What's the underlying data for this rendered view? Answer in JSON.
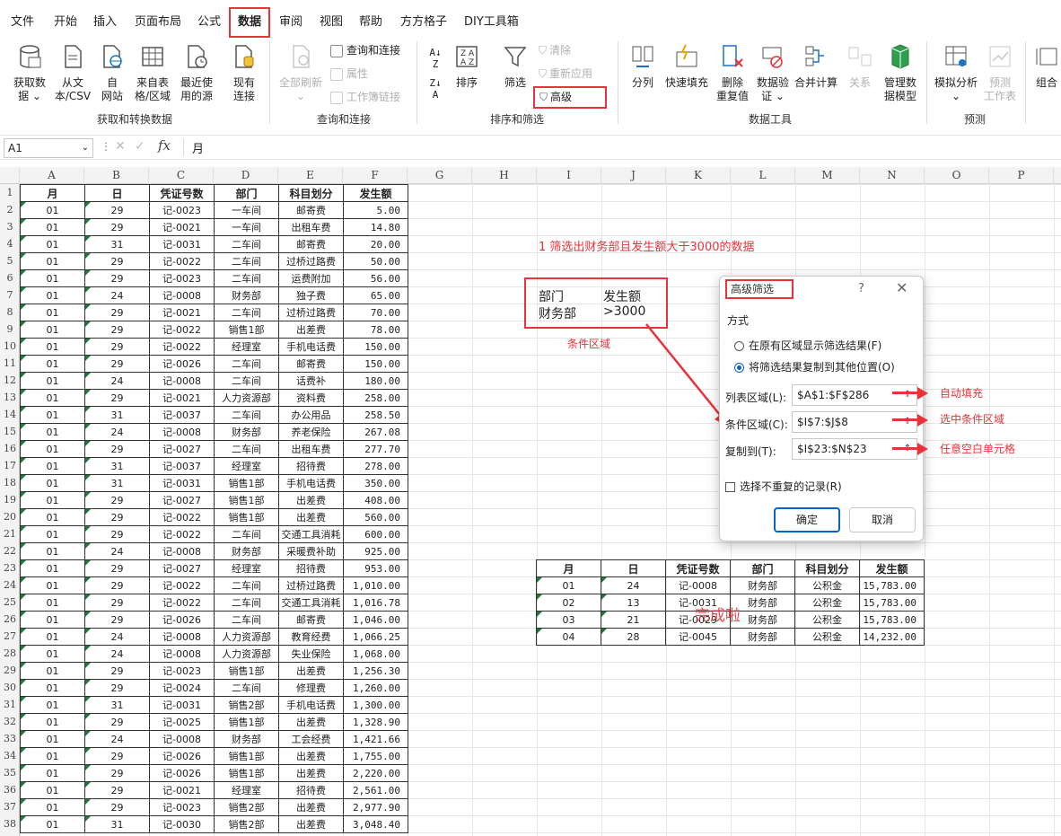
{
  "tabs": [
    "文件",
    "开始",
    "插入",
    "页面布局",
    "公式",
    "数据",
    "审阅",
    "视图",
    "帮助",
    "方方格子",
    "DIY工具箱"
  ],
  "ribbon": {
    "get_data": [
      "获取数\n据 ⌄",
      "从文\n本/CSV",
      "自\n网站",
      "来自表\n格/区域",
      "最近使\n用的源",
      "现有\n连接"
    ],
    "group1": "获取和转换数据",
    "refresh_all": "全部刷新\n⌄",
    "queries": [
      "查询和连接",
      "属性",
      "工作簿链接"
    ],
    "group2": "查询和连接",
    "sort": "排序",
    "filter": "筛选",
    "clear": "清除",
    "reapply": "重新应用",
    "advanced": "高级",
    "group3": "排序和筛选",
    "tools": [
      "分列",
      "快速填充",
      "删除\n重复值",
      "数据验\n证 ⌄",
      "合并计算",
      "关系",
      "管理数\n据模型"
    ],
    "group4": "数据工具",
    "forecast": [
      "模拟分析\n⌄",
      "预测\n工作表"
    ],
    "group5": "预测",
    "outline": "组合"
  },
  "formula_bar": {
    "name_box": "A1",
    "value": "月"
  },
  "columns": [
    "A",
    "B",
    "C",
    "D",
    "E",
    "F",
    "G",
    "H",
    "I",
    "J",
    "K",
    "L",
    "M",
    "N",
    "O",
    "P"
  ],
  "rows": [
    "1",
    "2",
    "3",
    "4",
    "5",
    "6",
    "7",
    "8",
    "9",
    "10",
    "11",
    "12",
    "13",
    "14",
    "15",
    "16",
    "17",
    "18",
    "19",
    "20",
    "21",
    "22",
    "23",
    "24",
    "25",
    "26",
    "27",
    "28",
    "29",
    "30",
    "31",
    "32",
    "33",
    "34",
    "35",
    "36",
    "37",
    "38"
  ],
  "headers": [
    "月",
    "日",
    "凭证号数",
    "部门",
    "科目划分",
    "发生额"
  ],
  "records": [
    [
      "01",
      "29",
      "记-0023",
      "一车间",
      "邮寄费",
      "5.00"
    ],
    [
      "01",
      "29",
      "记-0021",
      "一车间",
      "出租车费",
      "14.80"
    ],
    [
      "01",
      "31",
      "记-0031",
      "二车间",
      "邮寄费",
      "20.00"
    ],
    [
      "01",
      "29",
      "记-0022",
      "二车间",
      "过桥过路费",
      "50.00"
    ],
    [
      "01",
      "29",
      "记-0023",
      "二车间",
      "运费附加",
      "56.00"
    ],
    [
      "01",
      "24",
      "记-0008",
      "财务部",
      "独子费",
      "65.00"
    ],
    [
      "01",
      "29",
      "记-0021",
      "二车间",
      "过桥过路费",
      "70.00"
    ],
    [
      "01",
      "29",
      "记-0022",
      "销售1部",
      "出差费",
      "78.00"
    ],
    [
      "01",
      "29",
      "记-0022",
      "经理室",
      "手机电话费",
      "150.00"
    ],
    [
      "01",
      "29",
      "记-0026",
      "二车间",
      "邮寄费",
      "150.00"
    ],
    [
      "01",
      "24",
      "记-0008",
      "二车间",
      "话费补",
      "180.00"
    ],
    [
      "01",
      "29",
      "记-0021",
      "人力资源部",
      "资料费",
      "258.00"
    ],
    [
      "01",
      "31",
      "记-0037",
      "二车间",
      "办公用品",
      "258.50"
    ],
    [
      "01",
      "24",
      "记-0008",
      "财务部",
      "养老保险",
      "267.08"
    ],
    [
      "01",
      "29",
      "记-0027",
      "二车间",
      "出租车费",
      "277.70"
    ],
    [
      "01",
      "31",
      "记-0037",
      "经理室",
      "招待费",
      "278.00"
    ],
    [
      "01",
      "31",
      "记-0031",
      "销售1部",
      "手机电话费",
      "350.00"
    ],
    [
      "01",
      "29",
      "记-0027",
      "销售1部",
      "出差费",
      "408.00"
    ],
    [
      "01",
      "29",
      "记-0022",
      "销售1部",
      "出差费",
      "560.00"
    ],
    [
      "01",
      "29",
      "记-0022",
      "二车间",
      "交通工具消耗",
      "600.00"
    ],
    [
      "01",
      "24",
      "记-0008",
      "财务部",
      "采暖费补助",
      "925.00"
    ],
    [
      "01",
      "29",
      "记-0027",
      "经理室",
      "招待费",
      "953.00"
    ],
    [
      "01",
      "29",
      "记-0022",
      "二车间",
      "过桥过路费",
      "1,010.00"
    ],
    [
      "01",
      "29",
      "记-0022",
      "二车间",
      "交通工具消耗",
      "1,016.78"
    ],
    [
      "01",
      "29",
      "记-0026",
      "二车间",
      "邮寄费",
      "1,046.00"
    ],
    [
      "01",
      "24",
      "记-0008",
      "人力资源部",
      "教育经费",
      "1,066.25"
    ],
    [
      "01",
      "24",
      "记-0008",
      "人力资源部",
      "失业保险",
      "1,068.00"
    ],
    [
      "01",
      "29",
      "记-0023",
      "销售1部",
      "出差费",
      "1,256.30"
    ],
    [
      "01",
      "29",
      "记-0024",
      "二车间",
      "修理费",
      "1,260.00"
    ],
    [
      "01",
      "31",
      "记-0031",
      "销售2部",
      "手机电话费",
      "1,300.00"
    ],
    [
      "01",
      "29",
      "记-0025",
      "销售1部",
      "出差费",
      "1,328.90"
    ],
    [
      "01",
      "24",
      "记-0008",
      "财务部",
      "工会经费",
      "1,421.66"
    ],
    [
      "01",
      "29",
      "记-0026",
      "销售1部",
      "出差费",
      "1,755.00"
    ],
    [
      "01",
      "29",
      "记-0026",
      "销售1部",
      "出差费",
      "2,220.00"
    ],
    [
      "01",
      "29",
      "记-0021",
      "经理室",
      "招待费",
      "2,561.00"
    ],
    [
      "01",
      "29",
      "记-0023",
      "销售2部",
      "出差费",
      "2,977.90"
    ],
    [
      "01",
      "31",
      "记-0030",
      "销售2部",
      "出差费",
      "3,048.40"
    ]
  ],
  "annotation_title": "1 筛选出财务部且发生额大于3000的数据",
  "criteria": {
    "h1": "部门",
    "h2": "发生额",
    "v1": "财务部",
    "v2": ">3000",
    "caption": "条件区域"
  },
  "dialog": {
    "title": "高级筛选",
    "help": "?",
    "close": "✕",
    "section": "方式",
    "opt1": "在原有区域显示筛选结果(F)",
    "opt2": "将筛选结果复制到其他位置(O)",
    "list_label": "列表区域(L):",
    "list_value": "$A$1:$F$286",
    "crit_label": "条件区域(C):",
    "crit_value": "$I$7:$J$8",
    "copy_label": "复制到(T):",
    "copy_value": "$I$23:$N$23",
    "unique": "选择不重复的记录(R)",
    "ok": "确定",
    "cancel": "取消"
  },
  "notes": [
    "自动填充",
    "选中条件区域",
    "任意空白单元格"
  ],
  "result_headers": [
    "月",
    "日",
    "凭证号数",
    "部门",
    "科目划分",
    "发生额"
  ],
  "results": [
    [
      "01",
      "24",
      "记-0008",
      "财务部",
      "公积金",
      "15,783.00"
    ],
    [
      "02",
      "13",
      "记-0031",
      "财务部",
      "公积金",
      "15,783.00"
    ],
    [
      "03",
      "21",
      "记-0029",
      "财务部",
      "公积金",
      "15,783.00"
    ],
    [
      "04",
      "28",
      "记-0045",
      "财务部",
      "公积金",
      "14,232.00"
    ]
  ],
  "done_text": "完成啦",
  "colors": {
    "accent": "#e8333a",
    "excel_green": "#1d7a3b",
    "blue": "#0a62c4"
  }
}
